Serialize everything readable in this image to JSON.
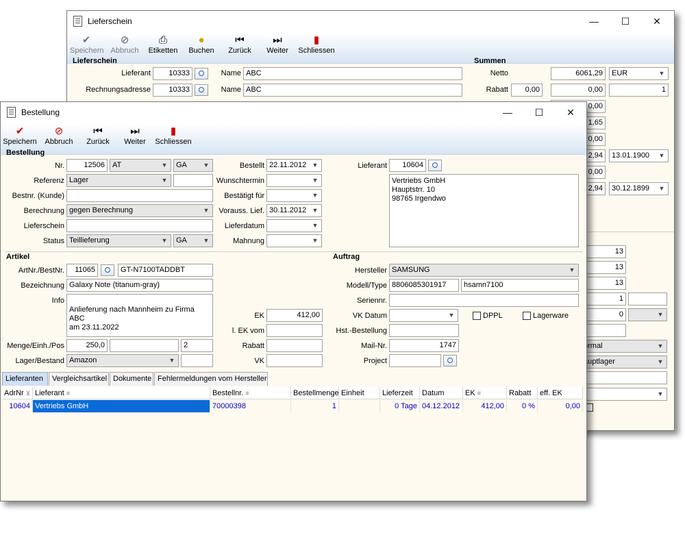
{
  "back": {
    "title": "Lieferschein",
    "toolbar": [
      "Speichern",
      "Abbruch",
      "Etiketten",
      "Buchen",
      "Zurück",
      "Weiter",
      "Schliessen"
    ],
    "section_left": "Lieferschein",
    "section_right": "Summen",
    "lieferant_label": "Lieferant",
    "lieferant_value": "10333",
    "rechnungsadresse_label": "Rechnungsadresse",
    "rechnungsadresse_value": "10333",
    "name_label": "Name",
    "name1": "ABC",
    "name2": "ABC",
    "netto_label": "Netto",
    "netto_value": "6061,29",
    "currency": "EUR",
    "rabatt_label": "Rabatt",
    "rabatt_pct": "0,00",
    "rabatt_value": "0,00",
    "rabatt_qty": "1",
    "col_values": [
      "0,00",
      "1,65",
      "0,00",
      "2,94",
      "0,00",
      "2,94"
    ],
    "date1": "13.01.1900",
    "date2": "30.12.1899",
    "nums": [
      "13",
      "13",
      "13",
      "1",
      "0"
    ],
    "sel1": "ormal",
    "sel2": "auptlager"
  },
  "front": {
    "title": "Bestellung",
    "toolbar": [
      "Speichern",
      "Abbruch",
      "Zurück",
      "Weiter",
      "Schliessen"
    ],
    "section_bestellung": "Bestellung",
    "nr_label": "Nr.",
    "nr_value": "12506",
    "nr_sel1": "AT",
    "nr_sel2": "GA",
    "referenz_label": "Referenz",
    "referenz_value": "Lager",
    "bestnr_kunde_label": "Bestnr. (Kunde)",
    "berechnung_label": "Berechnung",
    "berechnung_value": "gegen Berechnung",
    "lieferschein_label": "Lieferschein",
    "status_label": "Status",
    "status_value": "Teillieferung",
    "status_sel2": "GA",
    "bestellt_label": "Bestellt",
    "bestellt_value": "22.11.2012",
    "wunschtermin_label": "Wunschtermin",
    "bestaetigt_label": "Bestätigt für",
    "vorauss_label": "Vorauss. Lief.",
    "vorauss_value": "30.11.2012",
    "lieferdatum_label": "Lieferdatum",
    "mahnung_label": "Mahnung",
    "lieferant_label": "Lieferant",
    "lieferant_value": "10604",
    "lieferant_address": "Vertriebs GmbH\nHauptstrr. 10\n98765 Irgendwo",
    "section_artikel": "Artikel",
    "artnr_label": "ArtNr./BestNr.",
    "artnr_value": "11065",
    "bestnr_value": "GT-N7100TADDBT",
    "bezeichnung_label": "Bezeichnung",
    "bezeichnung_value": "Galaxy Note (titanum-gray)",
    "info_label": "Info",
    "info_value": "Anlieferung nach Mannheim zu Firma ABC\nam 23.11.2022",
    "menge_label": "Menge/Einh./Pos",
    "menge_value": "250,0",
    "pos_value": "2",
    "lager_label": "Lager/Bestand",
    "lager_value": "Amazon",
    "ek_label": "EK",
    "ek_value": "412,00",
    "lekvom_label": "l. EK vom",
    "rabatt_label": "Rabatt",
    "vk_label": "VK",
    "section_auftrag": "Auftrag",
    "hersteller_label": "Hersteller",
    "hersteller_value": "SAMSUNG",
    "modell_label": "Modell/Type",
    "modell_value": "8806085301917",
    "type_value": "hsamn7100",
    "seriennr_label": "Seriennr.",
    "vkdatum_label": "VK Datum",
    "dppl_label": "DPPL",
    "lagerware_label": "Lagerware",
    "hstbest_label": "Hst.-Bestellung",
    "mailnr_label": "Mail-Nr.",
    "mailnr_value": "1747",
    "project_label": "Project",
    "tabs": [
      "Lieferanten",
      "Vergleichsartikel",
      "Dokumente",
      "Fehlermeldungen vom Hersteller"
    ],
    "grid_headers": [
      "AdrNr",
      "Lieferant",
      "Bestellnr.",
      "Bestellmenge",
      "Einheit",
      "Lieferzeit",
      "Datum",
      "EK",
      "Rabatt",
      "eff. EK"
    ],
    "grid_row": [
      "10604",
      "Vertriebs GmbH",
      "70000398",
      "1",
      "",
      "0 Tage",
      "04.12.2012",
      "412,00",
      "0 %",
      "0,00"
    ]
  },
  "colors": {
    "toolbar_gradient_end": "#d6e4f3",
    "window_bg": "#fffaf0",
    "selection": "#0a6bd8",
    "link_text": "#0000cc"
  }
}
